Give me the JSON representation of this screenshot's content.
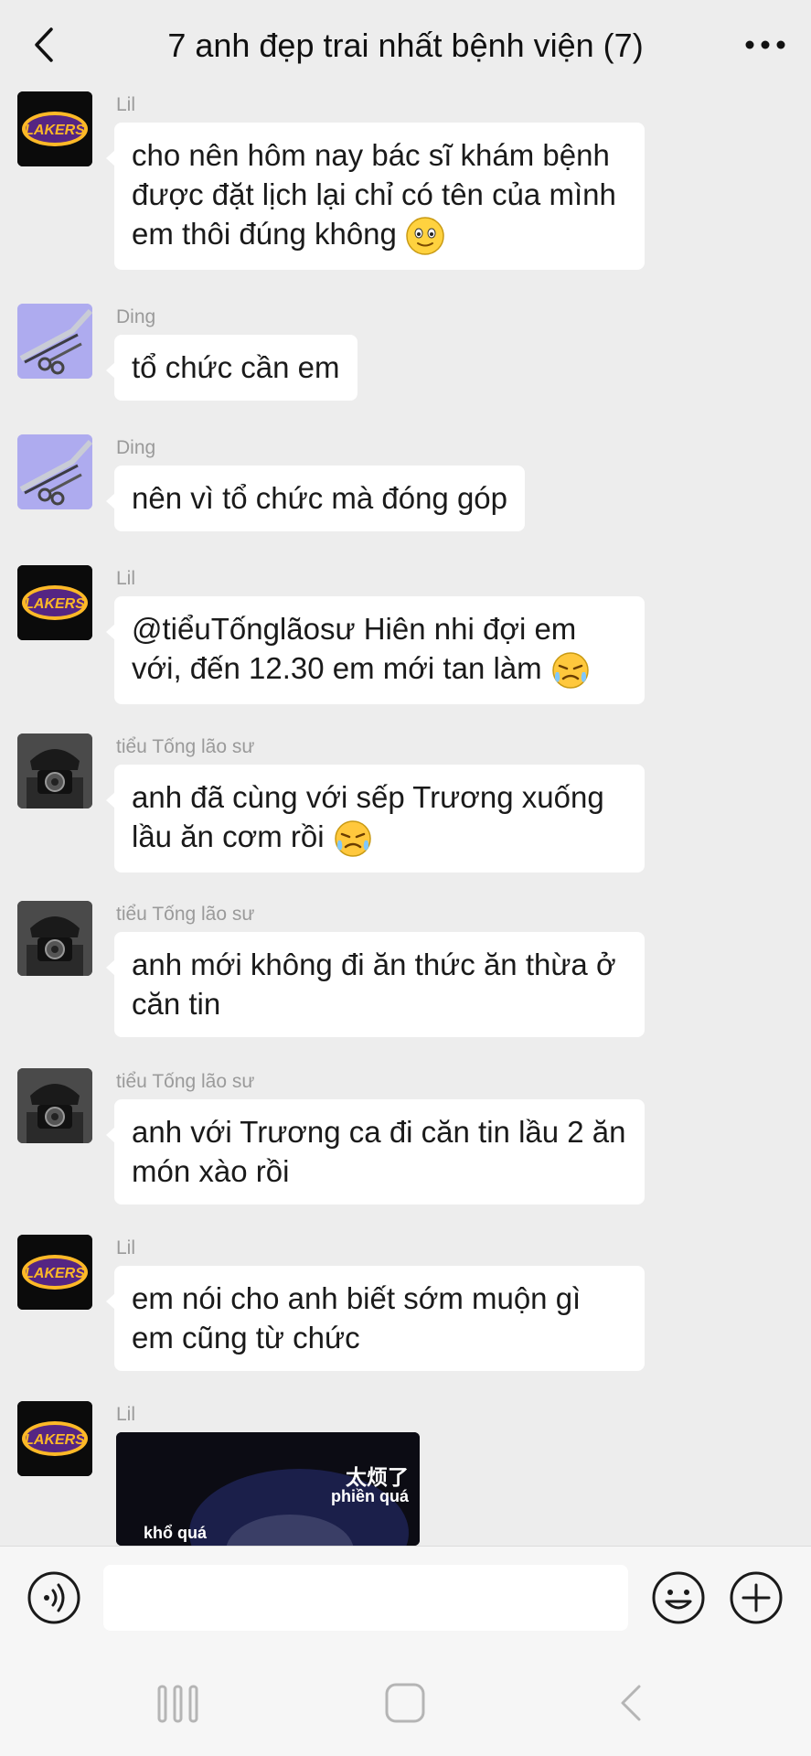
{
  "header": {
    "title": "7 anh đẹp trai nhất bệnh viện (7)",
    "back_icon": "chevron-left-icon",
    "more_icon": "more-dots-icon"
  },
  "messages": [
    {
      "sender": "Lil",
      "avatar": "lakers-logo",
      "text": "cho nên hôm nay bác sĩ khám bệnh được đặt lịch lại chỉ có tên của mình em thôi đúng không",
      "emoji": "smile-emoji"
    },
    {
      "sender": "Ding",
      "avatar": "surgical-tools",
      "text": "tổ chức cần em"
    },
    {
      "sender": "Ding",
      "avatar": "surgical-tools",
      "text": "nên vì tổ chức mà đóng góp"
    },
    {
      "sender": "Lil",
      "avatar": "lakers-logo",
      "text": "@tiểuTốnglãosư Hiên nhi đợi em với, đến 12.30 em mới tan làm",
      "emoji": "crying-emoji"
    },
    {
      "sender": "tiểu Tống lão sư",
      "avatar": "camera-person",
      "text": "anh đã cùng với sếp Trương xuống lầu ăn cơm rồi",
      "emoji": "crying-emoji"
    },
    {
      "sender": "tiểu Tống lão sư",
      "avatar": "camera-person",
      "text": "anh mới không đi ăn thức ăn thừa ở căn tin"
    },
    {
      "sender": "tiểu Tống lão sư",
      "avatar": "camera-person",
      "text": "anh với Trương ca đi căn tin lầu 2 ăn món xào rồi"
    },
    {
      "sender": "Lil",
      "avatar": "lakers-logo",
      "text": "em nói cho anh biết sớm muộn gì em cũng từ chức"
    },
    {
      "sender": "Lil",
      "avatar": "lakers-logo",
      "sticker": {
        "zh": "太烦了",
        "vi": "phiền quá",
        "vi2": "khổ quá"
      }
    }
  ],
  "avatar_text": {
    "lakers": "LAKERS"
  },
  "input": {
    "placeholder": "",
    "value": ""
  },
  "colors": {
    "background": "#ededed",
    "bubble": "#ffffff",
    "sender": "#9a9a9a",
    "lakers_purple": "#552583",
    "lakers_gold": "#fdb927"
  }
}
